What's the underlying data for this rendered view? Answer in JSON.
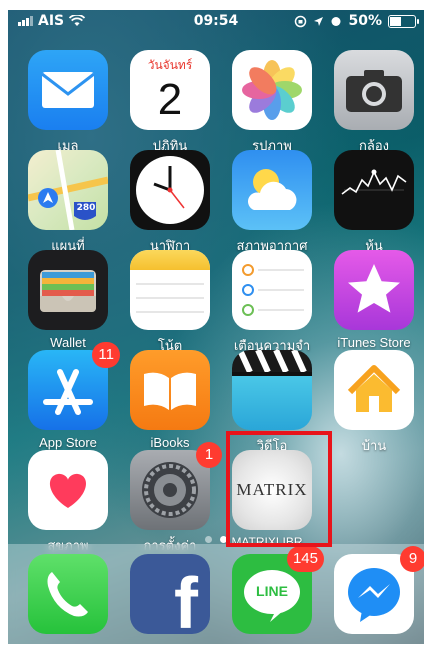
{
  "status": {
    "carrier": "AIS",
    "time": "09:54",
    "battery": "50%",
    "battery_level": 0.5
  },
  "apps": {
    "mail": "เมล",
    "calendar": "ปฏิทิน",
    "calendar_weekday": "วันจันทร์",
    "calendar_day": "2",
    "photos": "รูปภาพ",
    "camera": "กล้อง",
    "maps": "แผนที่",
    "maps_shield": "280",
    "clock": "นาฬิกา",
    "weather": "สภาพอากาศ",
    "stocks": "หุ้น",
    "wallet": "Wallet",
    "notes": "โน้ต",
    "reminders": "เตือนความจำ",
    "itunes": "iTunes Store",
    "appstore": "App Store",
    "appstore_badge": "11",
    "ibooks": "iBooks",
    "videos": "วิดีโอ",
    "home": "บ้าน",
    "health": "สุขภาพ",
    "settings": "การตั้งค่า",
    "settings_badge": "1",
    "matrix": "MATRIXLIBR...",
    "matrix_logo": "MATRIX"
  },
  "dock": {
    "facebook_glyph": "f",
    "line_text": "LINE",
    "line_badge": "145",
    "messenger_badge": "9"
  },
  "page_dots": {
    "count": 2,
    "active": 1
  }
}
